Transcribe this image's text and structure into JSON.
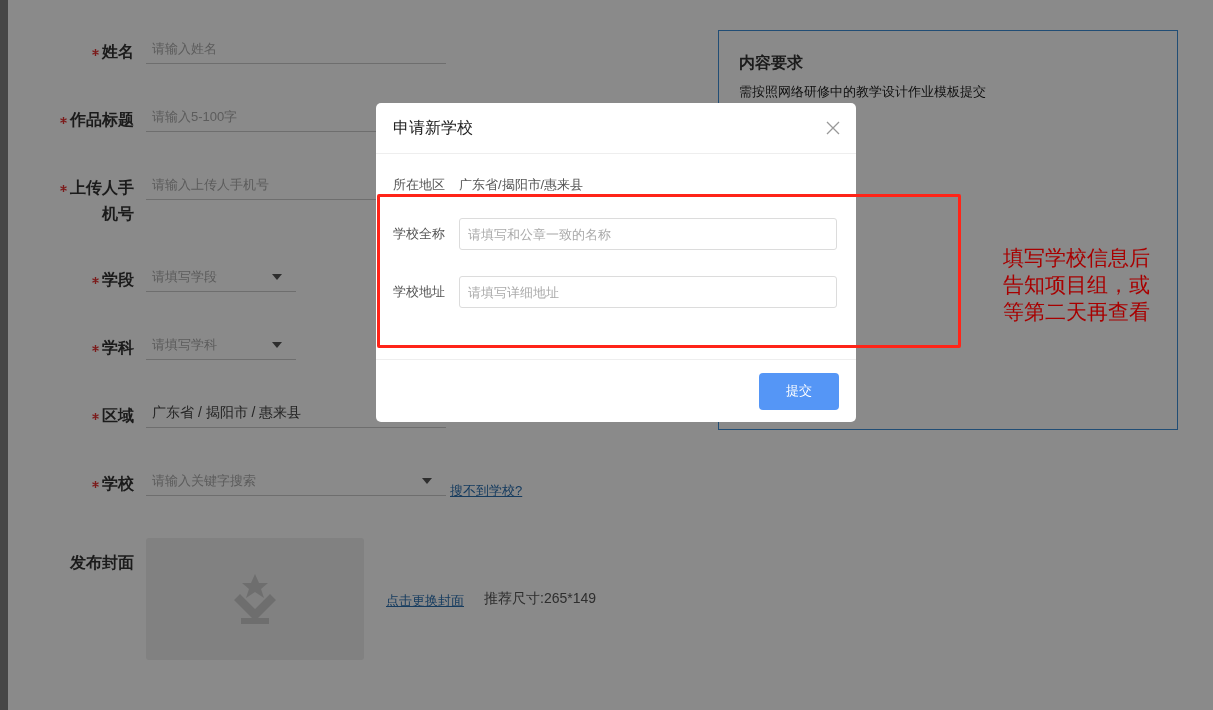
{
  "form": {
    "fields": [
      {
        "kind": "input",
        "label": "姓名",
        "required": true,
        "placeholder": "请输入姓名"
      },
      {
        "kind": "input",
        "label": "作品标题",
        "required": true,
        "placeholder": "请输入5-100字"
      },
      {
        "kind": "input",
        "label": "上传人手机号",
        "required": true,
        "placeholder": "请输入上传人手机号"
      },
      {
        "kind": "select",
        "label": "学段",
        "required": true,
        "placeholder": "请填写学段"
      },
      {
        "kind": "select",
        "label": "学科",
        "required": true,
        "placeholder": "请填写学科"
      },
      {
        "kind": "input",
        "label": "区域",
        "required": true,
        "value": "广东省 / 揭阳市 / 惠来县"
      },
      {
        "kind": "search",
        "label": "学校",
        "required": true,
        "placeholder": "请输入关键字搜索",
        "link": "搜不到学校?"
      }
    ],
    "cover": {
      "label": "发布封面",
      "link": "点击更换封面",
      "hint": "推荐尺寸:265*149"
    }
  },
  "requirements": {
    "title": "内容要求",
    "text": "需按照网络研修中的教学设计作业模板提交"
  },
  "dialog": {
    "title": "申请新学校",
    "region_label": "所在地区",
    "region_value": "广东省/揭阳市/惠来县",
    "fields": [
      {
        "label": "学校全称",
        "placeholder": "请填写和公章一致的名称"
      },
      {
        "label": "学校地址",
        "placeholder": "请填写详细地址"
      }
    ],
    "submit": "提交"
  },
  "annotation": {
    "text": "填写学校信息后告知项目组，或等第二天再查看"
  }
}
